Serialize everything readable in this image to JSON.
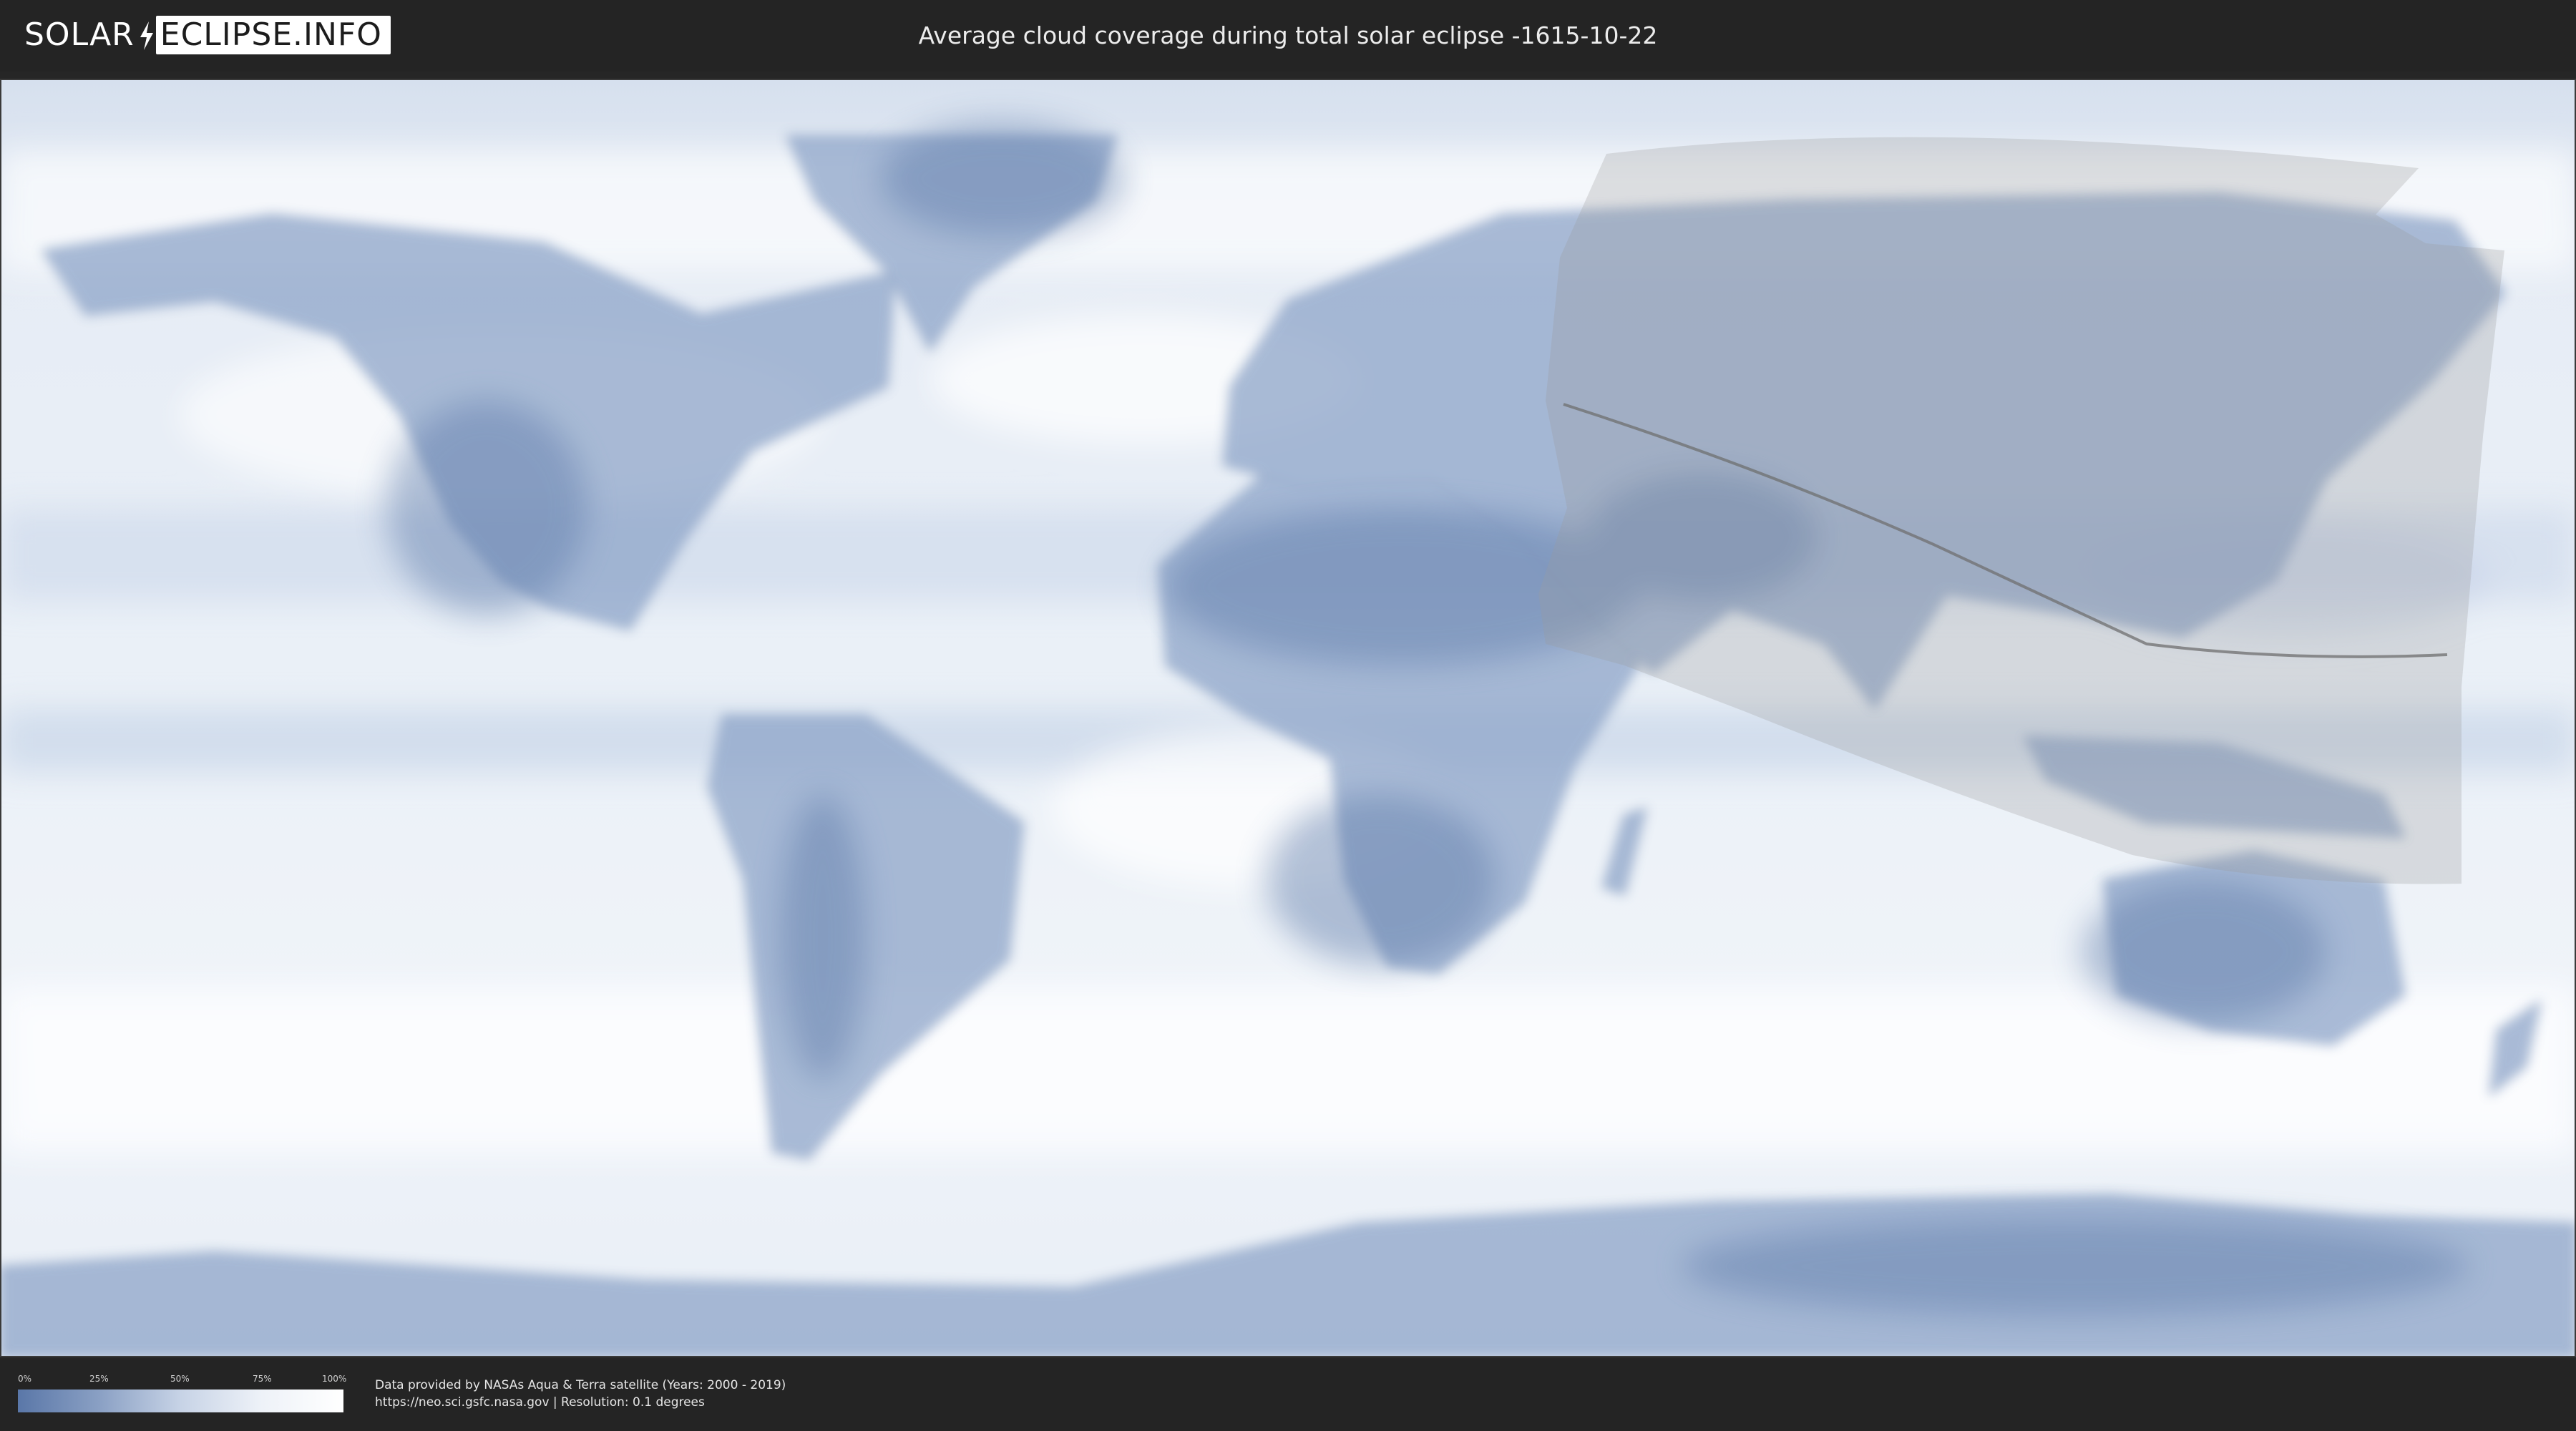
{
  "header": {
    "logo_left": "SOLAR",
    "logo_right": "ECLIPSE.INFO",
    "title": "Average cloud coverage during total solar eclipse -1615-10-22"
  },
  "legend": {
    "ticks": [
      "0%",
      "25%",
      "50%",
      "75%",
      "100%"
    ],
    "colors": [
      "#5a77a8",
      "#8aa0c4",
      "#c7d3e6",
      "#eef2f8",
      "#ffffff"
    ]
  },
  "credits": {
    "line1": "Data provided by NASAs Aqua & Terra satellite (Years: 2000 - 2019)",
    "line2": "https://neo.sci.gsfc.nasa.gov | Resolution: 0.1 degrees"
  },
  "map": {
    "ocean_color": "#eef2f8",
    "cloud_color": "#ffffff",
    "land_color": "#7f98c0",
    "overlay_color": "#9a9a9a"
  }
}
